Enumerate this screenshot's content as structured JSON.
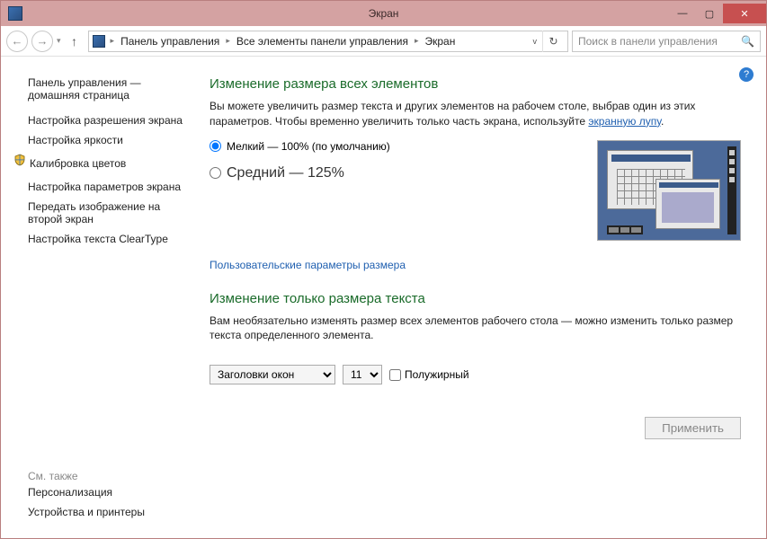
{
  "window": {
    "title": "Экран"
  },
  "breadcrumb": {
    "root_sep": "▸",
    "p1": "Панель управления",
    "p2": "Все элементы панели управления",
    "p3": "Экран"
  },
  "search": {
    "placeholder": "Поиск в панели управления"
  },
  "sidebar": {
    "home1": "Панель управления —",
    "home2": "домашняя страница",
    "items": [
      "Настройка разрешения экрана",
      "Настройка яркости",
      "Калибровка цветов",
      "Настройка параметров экрана",
      "Передать изображение на второй экран",
      "Настройка текста ClearType"
    ],
    "see_also_label": "См. также",
    "see_also": [
      "Персонализация",
      "Устройства и принтеры"
    ]
  },
  "main": {
    "heading1": "Изменение размера всех элементов",
    "desc_pre": "Вы можете увеличить размер текста и других элементов на рабочем столе, выбрав один из этих параметров. Чтобы временно увеличить только часть экрана, используйте ",
    "desc_link": "экранную лупу",
    "desc_post": ".",
    "radio1": "Мелкий — 100% (по умолчанию)",
    "radio2": "Средний — 125%",
    "custom_link": "Пользовательские параметры размера",
    "heading2": "Изменение только размера текста",
    "desc2": "Вам необязательно изменять размер всех элементов рабочего стола — можно изменить только размер текста определенного элемента.",
    "element_sel": "Заголовки окон",
    "size_sel": "11",
    "bold": "Полужирный",
    "apply": "Применить"
  }
}
